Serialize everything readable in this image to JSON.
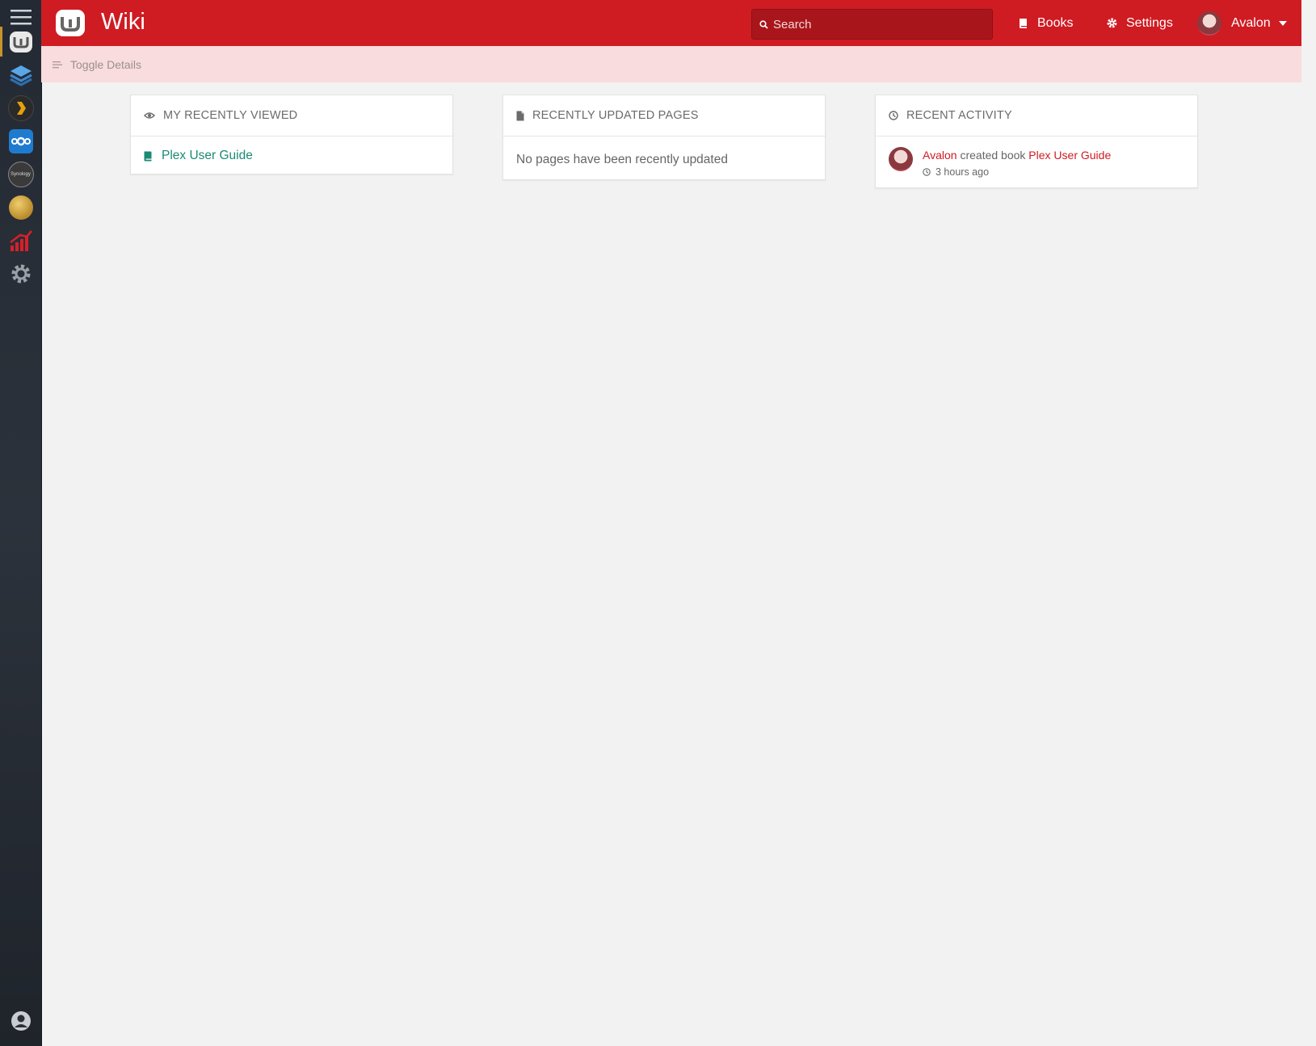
{
  "topbar": {
    "app_title": "Wiki",
    "search_placeholder": "Search",
    "nav": {
      "books_label": "Books",
      "settings_label": "Settings",
      "user_name": "Avalon"
    }
  },
  "details_bar": {
    "toggle_label": "Toggle Details"
  },
  "dock": {
    "items": [
      {
        "name": "menu-icon"
      },
      {
        "name": "wiki-app-icon",
        "active": true
      },
      {
        "name": "stack-app-icon"
      },
      {
        "name": "plex-app-icon"
      },
      {
        "name": "nextcloud-app-icon"
      },
      {
        "name": "synology-app-icon",
        "text": "Synology"
      },
      {
        "name": "coin-app-icon"
      },
      {
        "name": "stats-app-icon"
      },
      {
        "name": "settings-app-icon"
      },
      {
        "name": "user-account-icon"
      }
    ]
  },
  "cards": {
    "recently_viewed": {
      "title": "MY RECENTLY VIEWED",
      "items": [
        "Plex User Guide"
      ]
    },
    "recently_updated": {
      "title": "RECENTLY UPDATED PAGES",
      "empty_text": "No pages have been recently updated"
    },
    "recent_activity": {
      "title": "RECENT ACTIVITY",
      "entries": [
        {
          "user": "Avalon",
          "action": "created book",
          "target": "Plex User Guide",
          "time": "3 hours ago"
        }
      ]
    }
  },
  "colors": {
    "brand": "#cf1b22",
    "book_link": "#1a8a76",
    "activity_link": "#cf1b22"
  }
}
